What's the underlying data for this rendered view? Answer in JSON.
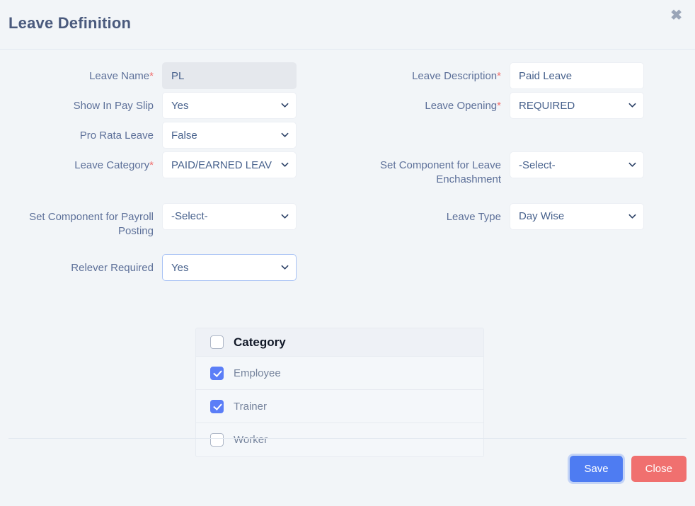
{
  "dialog": {
    "title": "Leave Definition",
    "close_icon": "close-x-icon"
  },
  "form": {
    "leave_name": {
      "label": "Leave Name",
      "required": "*",
      "value": "PL",
      "disabled": true
    },
    "leave_description": {
      "label": "Leave Description",
      "required": "*",
      "value": "Paid Leave"
    },
    "show_in_pay_slip": {
      "label": "Show In Pay Slip",
      "required": "",
      "value": "Yes"
    },
    "leave_opening": {
      "label": "Leave Opening",
      "required": "*",
      "value": "REQUIRED"
    },
    "pro_rata_leave": {
      "label": "Pro Rata Leave",
      "required": "",
      "value": "False"
    },
    "leave_category": {
      "label": "Leave Category",
      "required": "*",
      "value": "PAID/EARNED LEAV"
    },
    "set_component_leave_enchashment": {
      "label": "Set Component for Leave Enchashment",
      "required": "",
      "value": "-Select-"
    },
    "set_component_payroll_posting": {
      "label": "Set Component for Payroll Posting",
      "required": "",
      "value": "-Select-"
    },
    "leave_type": {
      "label": "Leave Type",
      "required": "",
      "value": "Day Wise"
    },
    "relever_required": {
      "label": "Relever Required",
      "required": "",
      "value": "Yes"
    }
  },
  "category_table": {
    "header": {
      "label": "Category",
      "checked": false
    },
    "rows": [
      {
        "label": "Employee",
        "checked": true
      },
      {
        "label": "Trainer",
        "checked": true
      },
      {
        "label": "Worker",
        "checked": false
      }
    ]
  },
  "footer": {
    "save_label": "Save",
    "close_label": "Close"
  },
  "colors": {
    "accent_blue": "#4e7cf2",
    "danger_red": "#f0706f",
    "checkbox_blue": "#5b7ef7",
    "label_text": "#5d7099",
    "required_asterisk": "#f0706f",
    "page_background": "#f2f5f8"
  }
}
